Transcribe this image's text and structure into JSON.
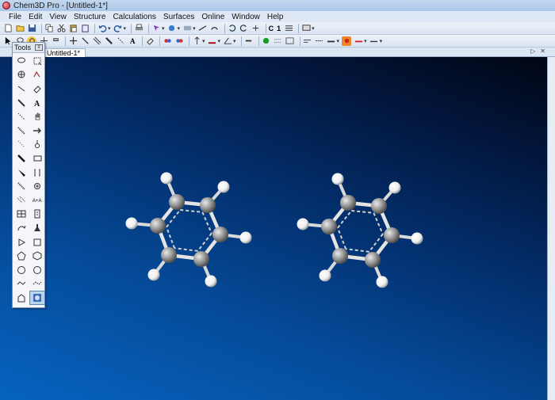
{
  "window": {
    "title": "Chem3D Pro - [Untitled-1*]"
  },
  "menu": [
    "File",
    "Edit",
    "View",
    "Structure",
    "Calculations",
    "Surfaces",
    "Online",
    "Window",
    "Help"
  ],
  "toolbar1": {
    "c_label": "C",
    "one_label": "1"
  },
  "tab": {
    "label": "Untitled-1*"
  },
  "tools_palette": {
    "title": "Tools",
    "tools": [
      "lasso-select-icon",
      "rectangle-select-icon",
      "move-icon",
      "rotate-icon",
      "single-bond-icon",
      "eraser-icon",
      "pencil-icon",
      "text-icon",
      "dashed-bond-icon",
      "hand-icon",
      "hashed-wedge-icon",
      "arrow-icon",
      "wavy-bond-icon",
      "atom-map-icon",
      "bold-bond-icon",
      "rectangle-icon",
      "wedge-bond-icon",
      "bracket-icon",
      "hashed-bond-icon",
      "charge-icon",
      "bond-hash-icon",
      "atom-label-icon",
      "table-icon",
      "template-icon",
      "curve-arrow-icon",
      "flask-icon",
      "triangle-icon",
      "square-icon",
      "pentagon-icon",
      "hexagon-icon",
      "circle-icon",
      "circle-alt-icon",
      "chain-icon",
      "chain-alt-icon",
      "house-icon",
      "molecule-view-icon"
    ]
  },
  "colors": {
    "canvas_top": "#010613",
    "canvas_bottom": "#0663bf",
    "carbon": "#9a9a9a",
    "hydrogen": "#ffffff"
  }
}
